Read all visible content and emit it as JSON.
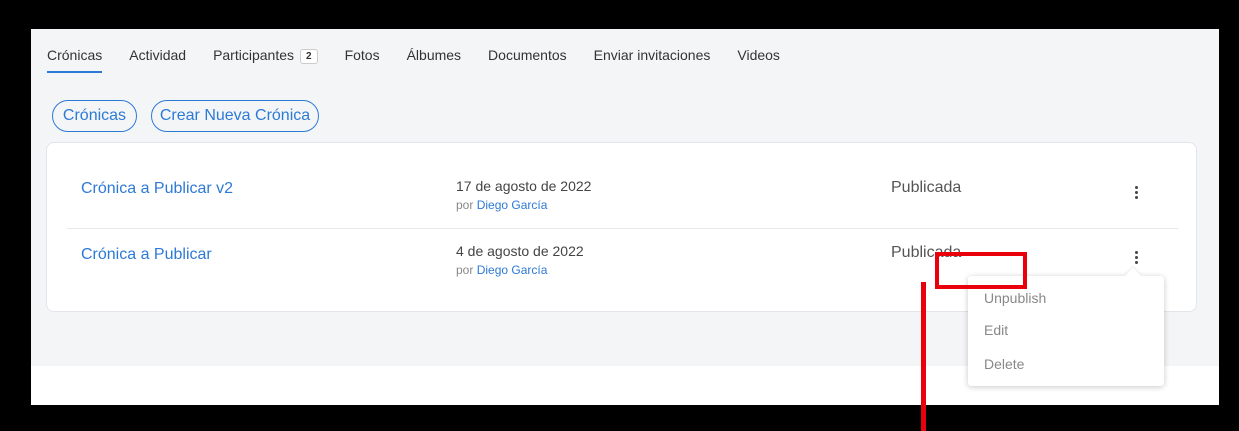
{
  "tabs": [
    {
      "label": "Crónicas"
    },
    {
      "label": "Actividad"
    },
    {
      "label": "Participantes",
      "badge": "2"
    },
    {
      "label": "Fotos"
    },
    {
      "label": "Álbumes"
    },
    {
      "label": "Documentos"
    },
    {
      "label": "Enviar invitaciones"
    },
    {
      "label": "Videos"
    }
  ],
  "active_tab": "Crónicas",
  "actions": {
    "cronicas_label": "Crónicas",
    "create_label": "Crear Nueva Crónica"
  },
  "entries": [
    {
      "title": "Crónica a Publicar v2",
      "date": "17 de agosto de 2022",
      "by_prefix": "por",
      "author": "Diego García",
      "status": "Publicada"
    },
    {
      "title": "Crónica a Publicar",
      "date": "4 de agosto de 2022",
      "by_prefix": "por",
      "author": "Diego García",
      "status": "Publicada"
    }
  ],
  "context_menu": {
    "items": [
      "Unpublish",
      "Edit",
      "Delete"
    ],
    "highlighted": "Unpublish"
  },
  "colors": {
    "accent": "#2d7ad6",
    "highlight": "#e8000b",
    "background": "#f4f5f7"
  }
}
